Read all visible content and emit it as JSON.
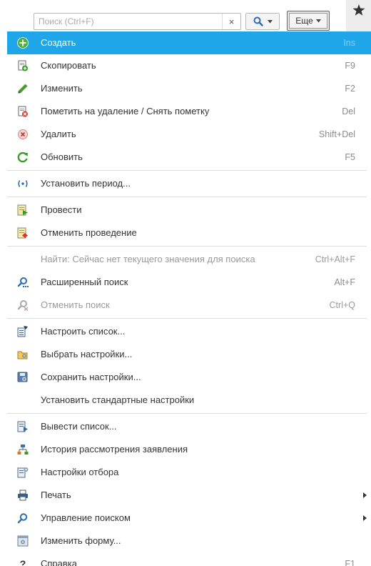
{
  "search": {
    "placeholder": "Поиск (Ctrl+F)",
    "value": "",
    "clear_glyph": "×"
  },
  "toolbar": {
    "more_label": "Еще",
    "find_icon": "search-icon",
    "star_icon": "star-icon"
  },
  "colors": {
    "highlight": "#1ea6e8",
    "accent_green": "#3a9a2a",
    "accent_blue": "#2a6db5"
  },
  "menu": {
    "items": [
      {
        "label": "Создать",
        "shortcut": "Ins",
        "icon": "add-icon"
      },
      {
        "label": "Скопировать",
        "shortcut": "F9",
        "icon": "copy-icon"
      },
      {
        "label": "Изменить",
        "shortcut": "F2",
        "icon": "pencil-icon"
      },
      {
        "label": "Пометить на удаление / Снять пометку",
        "shortcut": "Del",
        "icon": "mark-delete-icon"
      },
      {
        "label": "Удалить",
        "shortcut": "Shift+Del",
        "icon": "delete-icon"
      },
      {
        "label": "Обновить",
        "shortcut": "F5",
        "icon": "refresh-icon"
      },
      {
        "label": "Установить период...",
        "shortcut": "",
        "icon": "period-icon"
      },
      {
        "label": "Провести",
        "shortcut": "",
        "icon": "post-icon"
      },
      {
        "label": "Отменить проведение",
        "shortcut": "",
        "icon": "unpost-icon"
      },
      {
        "label": "Найти: Сейчас нет текущего значения для поиска",
        "shortcut": "Ctrl+Alt+F",
        "icon": ""
      },
      {
        "label": "Расширенный поиск",
        "shortcut": "Alt+F",
        "icon": "advanced-search-icon"
      },
      {
        "label": "Отменить поиск",
        "shortcut": "Ctrl+Q",
        "icon": "cancel-search-icon"
      },
      {
        "label": "Настроить список...",
        "shortcut": "",
        "icon": "configure-list-icon"
      },
      {
        "label": "Выбрать настройки...",
        "shortcut": "",
        "icon": "choose-settings-icon"
      },
      {
        "label": "Сохранить настройки...",
        "shortcut": "",
        "icon": "save-settings-icon"
      },
      {
        "label": "Установить стандартные настройки",
        "shortcut": "",
        "icon": ""
      },
      {
        "label": "Вывести список...",
        "shortcut": "",
        "icon": "export-list-icon"
      },
      {
        "label": "История рассмотрения заявления",
        "shortcut": "",
        "icon": "history-icon"
      },
      {
        "label": "Настройки отбора",
        "shortcut": "",
        "icon": "filter-settings-icon"
      },
      {
        "label": "Печать",
        "shortcut": "",
        "icon": "print-icon"
      },
      {
        "label": "Управление поиском",
        "shortcut": "",
        "icon": "search-icon"
      },
      {
        "label": "Изменить форму...",
        "shortcut": "",
        "icon": "change-form-icon"
      },
      {
        "label": "Справка",
        "shortcut": "F1",
        "icon": "help-icon"
      }
    ]
  }
}
